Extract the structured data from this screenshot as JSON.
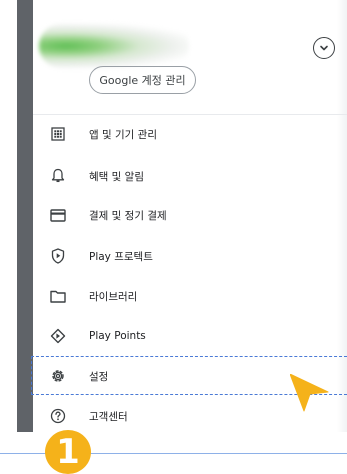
{
  "account": {
    "manage_label": "Google 계정 관리"
  },
  "menu": {
    "items": [
      {
        "label": "앱 및 기기 관리",
        "icon": "grid-icon"
      },
      {
        "label": "혜택 및 알림",
        "icon": "bell-icon"
      },
      {
        "label": "결제 및 정기 결제",
        "icon": "credit-card-icon"
      },
      {
        "label": "Play 프로텍트",
        "icon": "shield-play-icon"
      },
      {
        "label": "라이브러리",
        "icon": "folder-icon"
      },
      {
        "label": "Play Points",
        "icon": "diamond-icon"
      },
      {
        "label": "설정",
        "icon": "gear-icon"
      },
      {
        "label": "고객센터",
        "icon": "help-icon"
      }
    ]
  },
  "annotation": {
    "step_number": "1",
    "highlight_color": "#4a7ad6",
    "pointer_color": "#f5b21a"
  }
}
